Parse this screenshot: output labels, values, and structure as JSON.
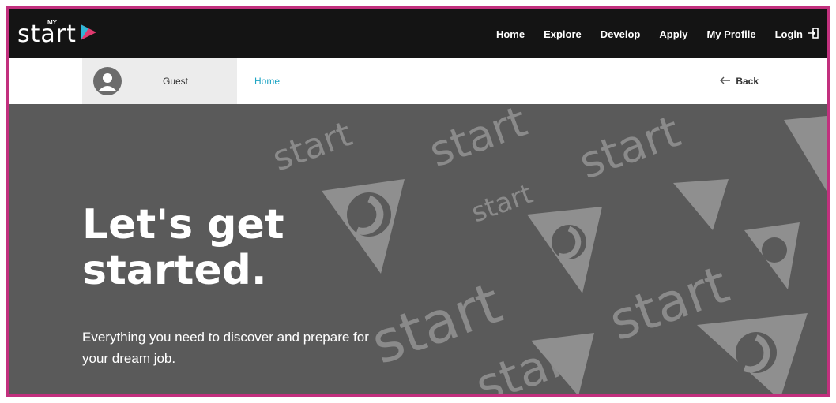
{
  "brand": {
    "name": "start",
    "small_text": "MY",
    "accent_colors": [
      "#2fb6d6",
      "#e03a6f"
    ]
  },
  "nav": {
    "items": [
      {
        "label": "Home"
      },
      {
        "label": "Explore"
      },
      {
        "label": "Develop"
      },
      {
        "label": "Apply"
      },
      {
        "label": "My Profile"
      }
    ],
    "login_label": "Login"
  },
  "user": {
    "label": "Guest"
  },
  "breadcrumb": {
    "label": "Home"
  },
  "back": {
    "label": "Back"
  },
  "hero": {
    "title": "Let's get started.",
    "subtitle": "Everything you need to discover and prepare for your dream job.",
    "watermark_word": "start"
  },
  "colors": {
    "frame": "#c2307e",
    "topnav_bg": "#141414",
    "hero_bg": "#5a5a5a",
    "link": "#1fa5c4"
  }
}
